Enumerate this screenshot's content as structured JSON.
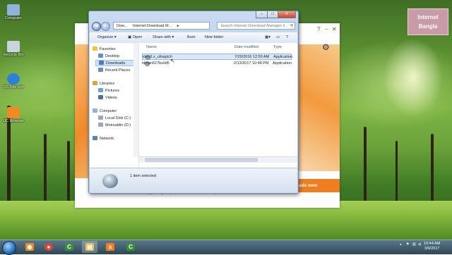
{
  "desktop": {
    "icons": [
      {
        "label": "Computer",
        "color": "#8fb3d9"
      },
      {
        "label": "Recycle Bin",
        "color": "#c9d4dc"
      },
      {
        "label": "OSToto Hot",
        "color": "#2a82d8"
      },
      {
        "label": "UC Browser",
        "color": "#f08a24"
      }
    ],
    "watermark": {
      "line1": "Internet",
      "line2": "Bangla"
    }
  },
  "idm_window": {
    "controls": [
      "?",
      "–",
      "✕"
    ],
    "settings_icon": "gear-icon",
    "upgrade_text": "Upgrade your protection now and save up to 60%",
    "upgrade_button": "ade now",
    "accent": "#f07d1f"
  },
  "explorer": {
    "title_controls": [
      "–",
      "□",
      "✕"
    ],
    "breadcrumb": [
      "Dow...",
      "Internet Download M...",
      "▸"
    ],
    "search_placeholder": "Search Internet Download Manager 6...",
    "toolbar": {
      "organize": "Organize",
      "open": "Open",
      "share_with": "Share with",
      "burn": "Burn",
      "new_folder": "New folder"
    },
    "nav": {
      "favorites": "Favorites",
      "desktop": "Desktop",
      "downloads": "Downloads",
      "recent_places": "Recent Places",
      "libraries": "Libraries",
      "pictures": "Pictures",
      "videos": "Videos",
      "computer": "Computer",
      "local_disk": "Local Disk (C:)",
      "moinuddin": "Moinuddin (D:)",
      "network": "Network"
    },
    "columns": {
      "name": "Name",
      "date": "Date modified",
      "type": "Type"
    },
    "files": [
      {
        "name": "idm.6.x_ultraptch",
        "date": "7/29/2016 12:59 AM",
        "type": "Application",
        "selected": true
      },
      {
        "name": "idman627build5",
        "date": "2/13/2017 10:48 PM",
        "type": "Application",
        "selected": false
      }
    ],
    "status": "1 item selected"
  },
  "taskbar": {
    "apps": [
      {
        "name": "uc-browser",
        "glyph": "◉",
        "color": "#f08a24"
      },
      {
        "name": "chrome",
        "glyph": "●",
        "color": "#d8473a"
      },
      {
        "name": "camtasia",
        "glyph": "C",
        "color": "#3b8d3b"
      },
      {
        "name": "explorer",
        "glyph": "▤",
        "color": "#e8c15a"
      },
      {
        "name": "avast",
        "glyph": "a",
        "color": "#f07d1f"
      },
      {
        "name": "camtasia-recorder",
        "glyph": "C",
        "color": "#3b8d3b"
      }
    ],
    "time": "10:44 AM",
    "date": "3/6/2017"
  }
}
